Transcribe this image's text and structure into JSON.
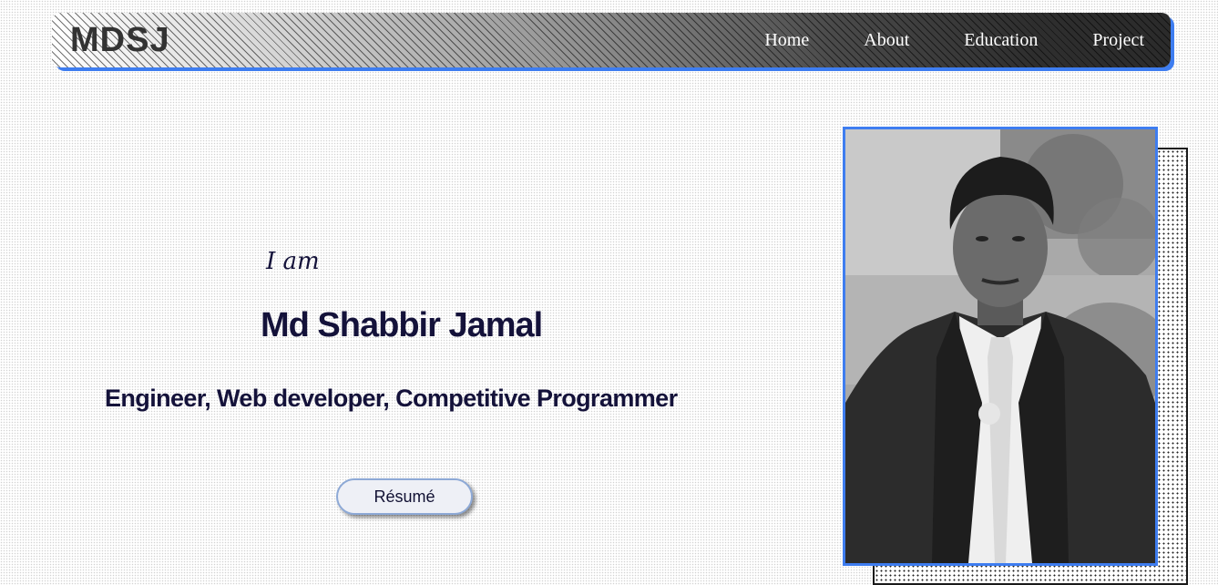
{
  "navbar": {
    "brand": "MDSJ",
    "links": [
      {
        "label": "Home"
      },
      {
        "label": "About"
      },
      {
        "label": "Education"
      },
      {
        "label": "Project"
      }
    ]
  },
  "hero": {
    "greeting": "I am",
    "name": "Md Shabbir Jamal",
    "roles": "Engineer, Web developer, Competitive Programmer",
    "resume_button": "Résumé"
  },
  "colors": {
    "accent": "#3e7df0",
    "text_dark": "#14123a",
    "nav_dark": "#2b2b2b"
  }
}
